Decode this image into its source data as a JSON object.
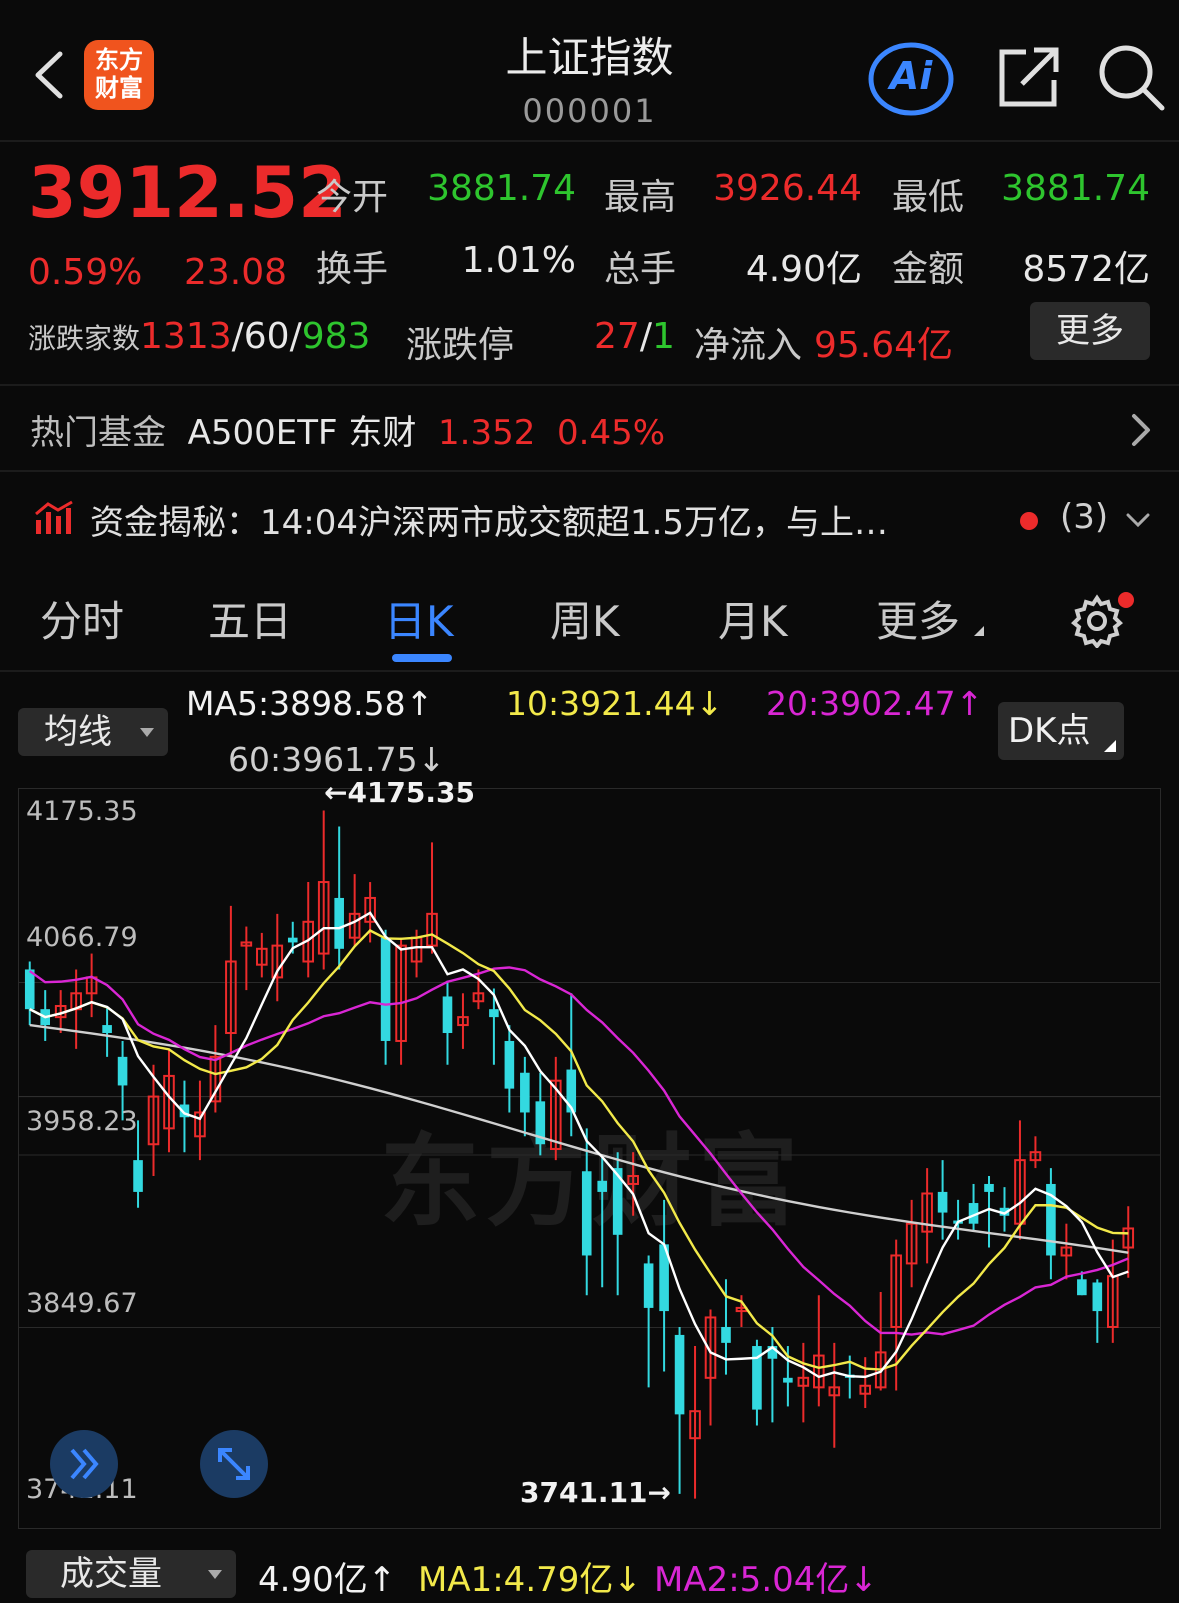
{
  "header": {
    "logo_line1": "东方",
    "logo_line2": "财富",
    "title": "上证指数",
    "code": "000001",
    "ai_label": "Ai"
  },
  "quote": {
    "price": "3912.52",
    "change_pct": "0.59%",
    "change_abs": "23.08",
    "open_label": "今开",
    "open": "3881.74",
    "high_label": "最高",
    "high": "3926.44",
    "low_label": "最低",
    "low": "3881.74",
    "turnover_label": "换手",
    "turnover": "1.01%",
    "volume_label": "总手",
    "volume": "4.90亿",
    "amount_label": "金额",
    "amount": "8572亿",
    "breadth_label": "涨跌家数",
    "breadth_up": "1313",
    "breadth_sep1": "/",
    "breadth_flat": "60",
    "breadth_sep2": "/",
    "breadth_down": "983",
    "limit_label": "涨跌停",
    "limit_up": "27",
    "limit_sep": "/",
    "limit_down": "1",
    "netflow_label": "净流入",
    "netflow": "95.64亿",
    "more_label": "更多"
  },
  "fund": {
    "label": "热门基金",
    "name": "A500ETF 东财",
    "price": "1.352",
    "pct": "0.45%"
  },
  "news": {
    "text": "资金揭秘：14:04沪深两市成交额超1.5万亿，与上…",
    "count": "(3)"
  },
  "tabs": [
    {
      "label": "分时"
    },
    {
      "label": "五日"
    },
    {
      "label": "日K"
    },
    {
      "label": "周K"
    },
    {
      "label": "月K"
    },
    {
      "label": "更多"
    }
  ],
  "ma_legend": {
    "select_label": "均线",
    "ma5": "MA5:3898.58↑",
    "ma10": "10:3921.44↓",
    "ma20": "20:3902.47↑",
    "ma60": "60:3961.75↓",
    "dk_label": "DK点"
  },
  "colors": {
    "up": "#ec2b2b",
    "down": "#2ec52e",
    "candle_down": "#33d9e0",
    "ma5": "#ffffff",
    "ma10": "#f2e94a",
    "ma20": "#d926d4",
    "ma60": "#cfcfcf",
    "accent": "#3b86ff"
  },
  "icons": {
    "back": "chevron-left-icon",
    "share": "share-icon",
    "search": "search-icon",
    "settings": "gear-icon",
    "expand": "double-chevron-right-icon",
    "fullscreen": "fullscreen-icon",
    "news": "bar-chart-icon"
  },
  "chart_data": {
    "type": "candlestick",
    "y_ticks": [
      "4175.35",
      "4066.79",
      "3958.23",
      "3849.67",
      "3741.11"
    ],
    "ylim": [
      3741.11,
      4175.35
    ],
    "high_marker": "←4175.35",
    "low_marker": "3741.11→",
    "watermark": "东方财富",
    "candles": [
      [
        4075,
        4050,
        4080,
        4040
      ],
      [
        4050,
        4040,
        4062,
        4030
      ],
      [
        4045,
        4052,
        4062,
        4035
      ],
      [
        4050,
        4060,
        4075,
        4025
      ],
      [
        4060,
        4070,
        4085,
        4045
      ],
      [
        4040,
        4035,
        4052,
        4020
      ],
      [
        4020,
        4002,
        4030,
        3980
      ],
      [
        3955,
        3935,
        3980,
        3925
      ],
      [
        3965,
        3995,
        4015,
        3945
      ],
      [
        3975,
        4008,
        4025,
        3960
      ],
      [
        3990,
        3982,
        4005,
        3960
      ],
      [
        3970,
        3985,
        4005,
        3955
      ],
      [
        3992,
        4020,
        4040,
        3985
      ],
      [
        4035,
        4080,
        4115,
        4020
      ],
      [
        4090,
        4092,
        4102,
        4062
      ],
      [
        4078,
        4088,
        4098,
        4070
      ],
      [
        4070,
        4090,
        4110,
        4055
      ],
      [
        4095,
        4092,
        4105,
        4085
      ],
      [
        4080,
        4105,
        4130,
        4070
      ],
      [
        4085,
        4130,
        4175,
        4075
      ],
      [
        4120,
        4088,
        4165,
        4075
      ],
      [
        4095,
        4110,
        4135,
        4090
      ],
      [
        4105,
        4120,
        4130,
        4092
      ],
      [
        4095,
        4030,
        4100,
        4015
      ],
      [
        4030,
        4090,
        4095,
        4015
      ],
      [
        4080,
        4095,
        4100,
        4070
      ],
      [
        4090,
        4110,
        4155,
        4085
      ],
      [
        4058,
        4035,
        4068,
        4015
      ],
      [
        4040,
        4045,
        4060,
        4025
      ],
      [
        4055,
        4060,
        4075,
        4050
      ],
      [
        4050,
        4045,
        4063,
        4015
      ],
      [
        4030,
        4000,
        4040,
        3985
      ],
      [
        4010,
        3985,
        4020,
        3970
      ],
      [
        3992,
        3965,
        4010,
        3958
      ],
      [
        3962,
        4005,
        4020,
        3955
      ],
      [
        4012,
        3985,
        4060,
        3970
      ],
      [
        3948,
        3895,
        3975,
        3870
      ],
      [
        3942,
        3935,
        3958,
        3875
      ],
      [
        3950,
        3908,
        3960,
        3870
      ],
      [
        3940,
        3945,
        3960,
        3920
      ],
      [
        3890,
        3862,
        3895,
        3812
      ],
      [
        3902,
        3860,
        3930,
        3822
      ],
      [
        3845,
        3795,
        3850,
        3745
      ],
      [
        3780,
        3797,
        3838,
        3742
      ],
      [
        3818,
        3856,
        3861,
        3788
      ],
      [
        3850,
        3840,
        3880,
        3820
      ],
      [
        3860,
        3862,
        3870,
        3850
      ],
      [
        3838,
        3798,
        3842,
        3788
      ],
      [
        3838,
        3830,
        3850,
        3790
      ],
      [
        3818,
        3815,
        3838,
        3800
      ],
      [
        3813,
        3818,
        3840,
        3790
      ],
      [
        3812,
        3832,
        3870,
        3800
      ],
      [
        3807,
        3812,
        3840,
        3774
      ],
      [
        3820,
        3818,
        3832,
        3805
      ],
      [
        3808,
        3813,
        3831,
        3799
      ],
      [
        3812,
        3834,
        3872,
        3810
      ],
      [
        3850,
        3895,
        3905,
        3810
      ],
      [
        3890,
        3915,
        3930,
        3875
      ],
      [
        3910,
        3934,
        3950,
        3890
      ],
      [
        3935,
        3922,
        3955,
        3905
      ],
      [
        3917,
        3915,
        3930,
        3905
      ],
      [
        3928,
        3915,
        3940,
        3910
      ],
      [
        3940,
        3935,
        3945,
        3900
      ],
      [
        3925,
        3920,
        3938,
        3910
      ],
      [
        3915,
        3955,
        3980,
        3905
      ],
      [
        3955,
        3960,
        3970,
        3950
      ],
      [
        3940,
        3895,
        3950,
        3880
      ],
      [
        3895,
        3900,
        3915,
        3880
      ],
      [
        3880,
        3870,
        3885,
        3870
      ],
      [
        3878,
        3860,
        3880,
        3840
      ],
      [
        3850,
        3882,
        3905,
        3840
      ],
      [
        3900,
        3912,
        3926,
        3881
      ]
    ]
  },
  "volume": {
    "select_label": "成交量",
    "value": "4.90亿↑",
    "ma1": "MA1:4.79亿↓",
    "ma2": "MA2:5.04亿↓"
  }
}
